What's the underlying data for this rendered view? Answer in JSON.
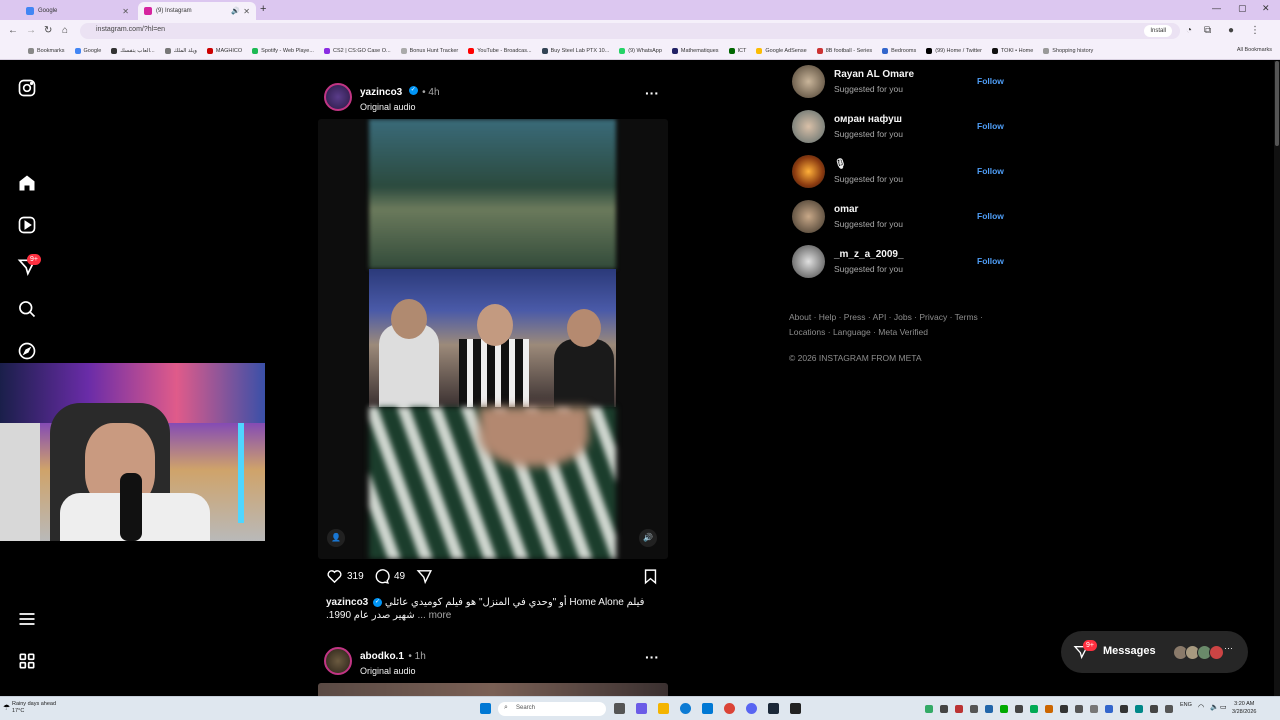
{
  "browser": {
    "tabs": [
      {
        "title": "Google",
        "active": false
      },
      {
        "title": "(9) Instagram",
        "active": true
      }
    ],
    "url": "instagram.com/?hl=en",
    "install_label": "Install",
    "bookmarks": [
      "Bookmarks",
      "Google",
      "العاب بنفسك...",
      "ويلد الملك",
      "MAGHICO",
      "Spotify - Web Playe...",
      "CS2 | CS:GO Case O...",
      "Bonus Hunt Tracker",
      "YouTube - Broadcas...",
      "Buy Steel Lab PTX 10...",
      "(9) WhatsApp",
      "Mathematiques",
      "ICT",
      "Google AdSense",
      "8B football - Series",
      "Bedrooms",
      "(99) Home / Twitter",
      "TOKI • Home",
      "Shopping history"
    ],
    "all_bookmarks": "All Bookmarks",
    "accent": "#dcc7f0"
  },
  "sidebar": {
    "icons": [
      "instagram-logo-icon",
      "home-icon",
      "reels-icon",
      "notifications-icon",
      "search-icon",
      "explore-icon",
      "menu-icon",
      "more-apps-icon"
    ],
    "notif_badge": "9+"
  },
  "post1": {
    "username": "yazinco3",
    "time": "• 4h",
    "audio": "Original audio",
    "likes": "319",
    "comments": "49",
    "caption_user": "yazinco3",
    "caption_text": "فيلم Home Alone أو \"وحدي في المنزل\" هو فيلم كوميدي عائلي شهير صدر عام 1990.",
    "caption_more": "... more"
  },
  "post2": {
    "username": "abodko.1",
    "time": "• 1h",
    "audio": "Original audio"
  },
  "suggestions": [
    {
      "name": "Rayan AL Omare",
      "sub": "Suggested for you",
      "follow": "Follow"
    },
    {
      "name": "омран нафуш",
      "sub": "Suggested for you",
      "follow": "Follow"
    },
    {
      "name": "🎙",
      "sub": "Suggested for you",
      "follow": "Follow"
    },
    {
      "name": "omar",
      "sub": "Suggested for you",
      "follow": "Follow"
    },
    {
      "name": "_m_z_a_2009_",
      "sub": "Suggested for you",
      "follow": "Follow"
    }
  ],
  "footer": {
    "links": "About · Help · Press · API · Jobs · Privacy · Terms · Locations · Language · Meta Verified",
    "copyright": "© 2026 INSTAGRAM FROM META"
  },
  "messages": {
    "label": "Messages",
    "badge": "9+"
  },
  "taskbar": {
    "weather_line1": "Rainy days ahead",
    "weather_line2": "17°C",
    "search_placeholder": "Search",
    "lang": "ENG",
    "time": "3:20 AM",
    "date": "3/28/2026"
  }
}
